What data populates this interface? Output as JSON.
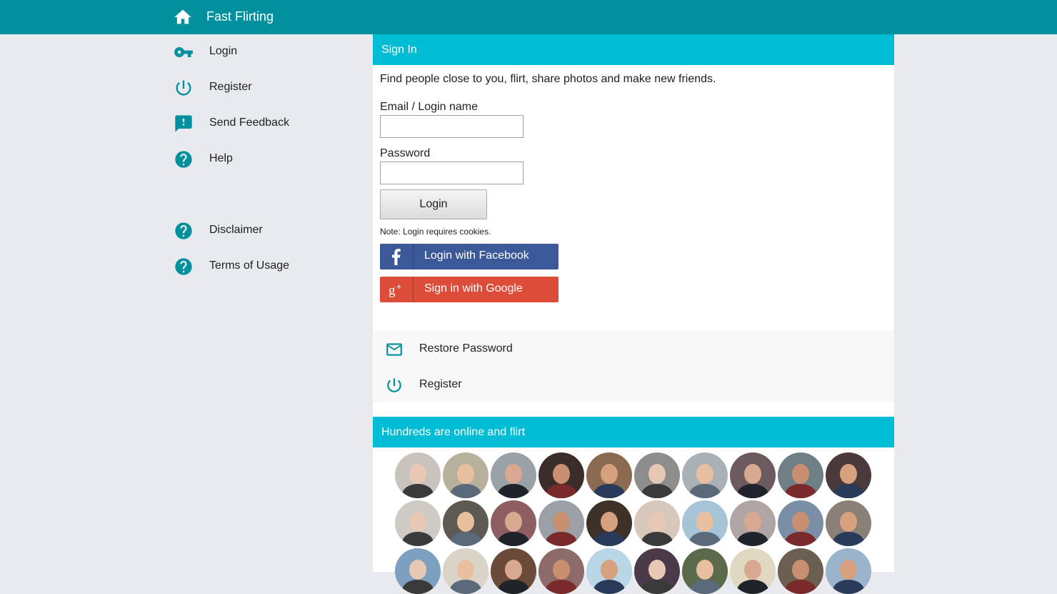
{
  "header": {
    "title": "Fast Flirting",
    "home_icon": "home-icon"
  },
  "sidebar": {
    "items": [
      {
        "key": "login",
        "label": "Login",
        "icon": "key-icon"
      },
      {
        "key": "register",
        "label": "Register",
        "icon": "power-icon"
      },
      {
        "key": "send-feedback",
        "label": "Send Feedback",
        "icon": "feedback-icon"
      },
      {
        "key": "help",
        "label": "Help",
        "icon": "help-icon"
      },
      {
        "key": "disclaimer",
        "label": "Disclaimer",
        "icon": "help-icon"
      },
      {
        "key": "terms-of-usage",
        "label": "Terms of Usage",
        "icon": "help-icon"
      }
    ]
  },
  "signin": {
    "title": "Sign In",
    "intro": "Find people close to you, flirt, share photos and make new friends.",
    "email_label": "Email / Login name",
    "email_value": "",
    "password_label": "Password",
    "password_value": "",
    "login_button": "Login",
    "note": "Note: Login requires cookies.",
    "facebook_button": "Login with Facebook",
    "google_button": "Sign in with Google"
  },
  "links": [
    {
      "label": "Restore Password",
      "icon": "mail-icon"
    },
    {
      "label": "Register",
      "icon": "power-icon"
    }
  ],
  "online": {
    "title": "Hundreds are online and flirt"
  },
  "colors": {
    "topbar": "#00909e",
    "accent": "#00bcd4",
    "icon": "#00909e",
    "facebook": "#3b5998",
    "google": "#dd4b39"
  }
}
